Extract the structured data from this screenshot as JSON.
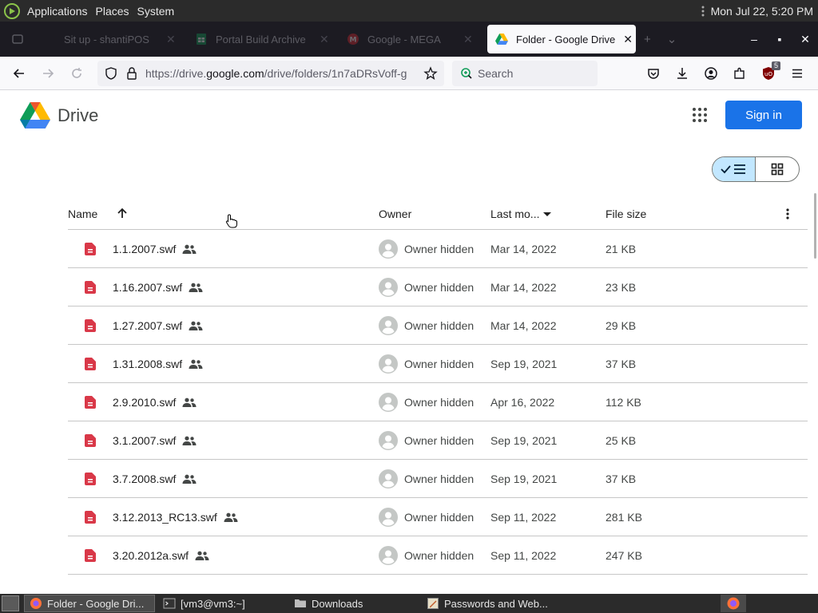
{
  "os_panel": {
    "menus": [
      "Applications",
      "Places",
      "System"
    ],
    "clock": "Mon Jul 22,  5:20 PM"
  },
  "browser": {
    "tabs": [
      {
        "label": "Sit up - shantiPOS",
        "icon": "page-icon"
      },
      {
        "label": "Portal Build Archive",
        "icon": "sheets-icon"
      },
      {
        "label": "Google - MEGA",
        "icon": "mega-icon"
      },
      {
        "label": "Folder - Google Drive",
        "icon": "drive-icon",
        "active": true
      }
    ],
    "url_prefix": "https://drive.",
    "url_host": "google.com",
    "url_path": "/drive/folders/1n7aDRsVoff-g",
    "search_placeholder": "Search",
    "extension_badge": "5"
  },
  "drive": {
    "title": "Drive",
    "sign_in": "Sign in",
    "columns": {
      "name": "Name",
      "owner": "Owner",
      "modified": "Last mo...",
      "size": "File size"
    },
    "files": [
      {
        "name": "1.1.2007.swf",
        "owner": "Owner hidden",
        "modified": "Mar 14, 2022",
        "size": "21 KB"
      },
      {
        "name": "1.16.2007.swf",
        "owner": "Owner hidden",
        "modified": "Mar 14, 2022",
        "size": "23 KB"
      },
      {
        "name": "1.27.2007.swf",
        "owner": "Owner hidden",
        "modified": "Mar 14, 2022",
        "size": "29 KB"
      },
      {
        "name": "1.31.2008.swf",
        "owner": "Owner hidden",
        "modified": "Sep 19, 2021",
        "size": "37 KB"
      },
      {
        "name": "2.9.2010.swf",
        "owner": "Owner hidden",
        "modified": "Apr 16, 2022",
        "size": "112 KB"
      },
      {
        "name": "3.1.2007.swf",
        "owner": "Owner hidden",
        "modified": "Sep 19, 2021",
        "size": "25 KB"
      },
      {
        "name": "3.7.2008.swf",
        "owner": "Owner hidden",
        "modified": "Sep 19, 2021",
        "size": "37 KB"
      },
      {
        "name": "3.12.2013_RC13.swf",
        "owner": "Owner hidden",
        "modified": "Sep 11, 2022",
        "size": "281 KB"
      },
      {
        "name": "3.20.2012a.swf",
        "owner": "Owner hidden",
        "modified": "Sep 11, 2022",
        "size": "247 KB"
      }
    ]
  },
  "taskbar": {
    "items": [
      {
        "label": "Folder - Google Dri...",
        "icon": "firefox-icon",
        "active": true
      },
      {
        "label": "[vm3@vm3:~]",
        "icon": "terminal-icon"
      },
      {
        "label": "Downloads",
        "icon": "folder-icon"
      },
      {
        "label": "Passwords and Web...",
        "icon": "edit-icon"
      }
    ]
  },
  "colors": {
    "accent": "#1a73e8",
    "toggle_on": "#c2e7ff",
    "file_icon": "#d93848"
  }
}
